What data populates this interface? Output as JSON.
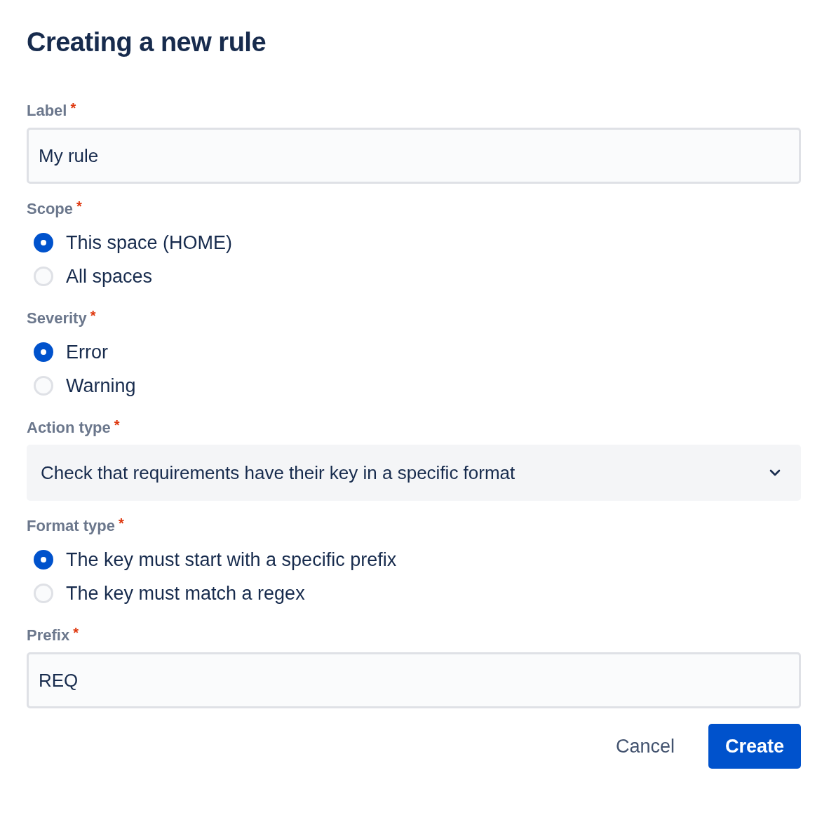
{
  "title": "Creating a new rule",
  "fields": [
    {
      "kind": "text",
      "label": "Label",
      "required_mark": "*",
      "value": "My rule"
    },
    {
      "kind": "radio",
      "label": "Scope",
      "required_mark": "*",
      "options": [
        {
          "label": "This space (HOME)",
          "selected": true
        },
        {
          "label": "All spaces",
          "selected": false
        }
      ]
    },
    {
      "kind": "radio",
      "label": "Severity",
      "required_mark": "*",
      "options": [
        {
          "label": "Error",
          "selected": true
        },
        {
          "label": "Warning",
          "selected": false
        }
      ]
    },
    {
      "kind": "select",
      "label": "Action type",
      "required_mark": "*",
      "value": "Check that requirements have their key in a specific format"
    },
    {
      "kind": "radio",
      "label": "Format type",
      "required_mark": "*",
      "options": [
        {
          "label": "The key must start with a specific prefix",
          "selected": true
        },
        {
          "label": "The key must match a regex",
          "selected": false
        }
      ]
    },
    {
      "kind": "text",
      "label": "Prefix",
      "required_mark": "*",
      "value": "REQ"
    }
  ],
  "buttons": [
    {
      "kind": "subtle",
      "label": "Cancel"
    },
    {
      "kind": "primary",
      "label": "Create"
    }
  ]
}
